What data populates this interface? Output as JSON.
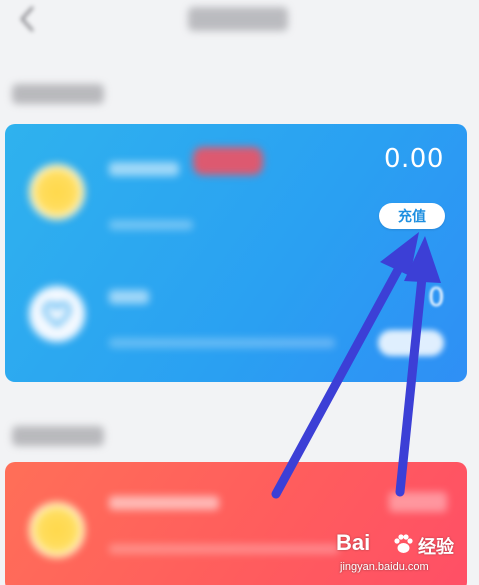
{
  "header": {
    "back_icon": "chevron-left-icon",
    "title": ""
  },
  "sections": {
    "wallet_title": "",
    "income_title": ""
  },
  "blue_card": {
    "balance": "0.00",
    "recharge_label": "充值",
    "second_value": "0",
    "colors": {
      "start": "#2fb2ee",
      "end": "#2f8ff5"
    }
  },
  "red_card": {
    "colors": {
      "start": "#ff6f58",
      "end": "#ff4f66"
    }
  },
  "annotation": {
    "arrow_color": "#3c3fd6"
  },
  "watermark": {
    "brand": "Bai",
    "brand_cn": "经验",
    "url": "jingyan.baidu.com"
  }
}
